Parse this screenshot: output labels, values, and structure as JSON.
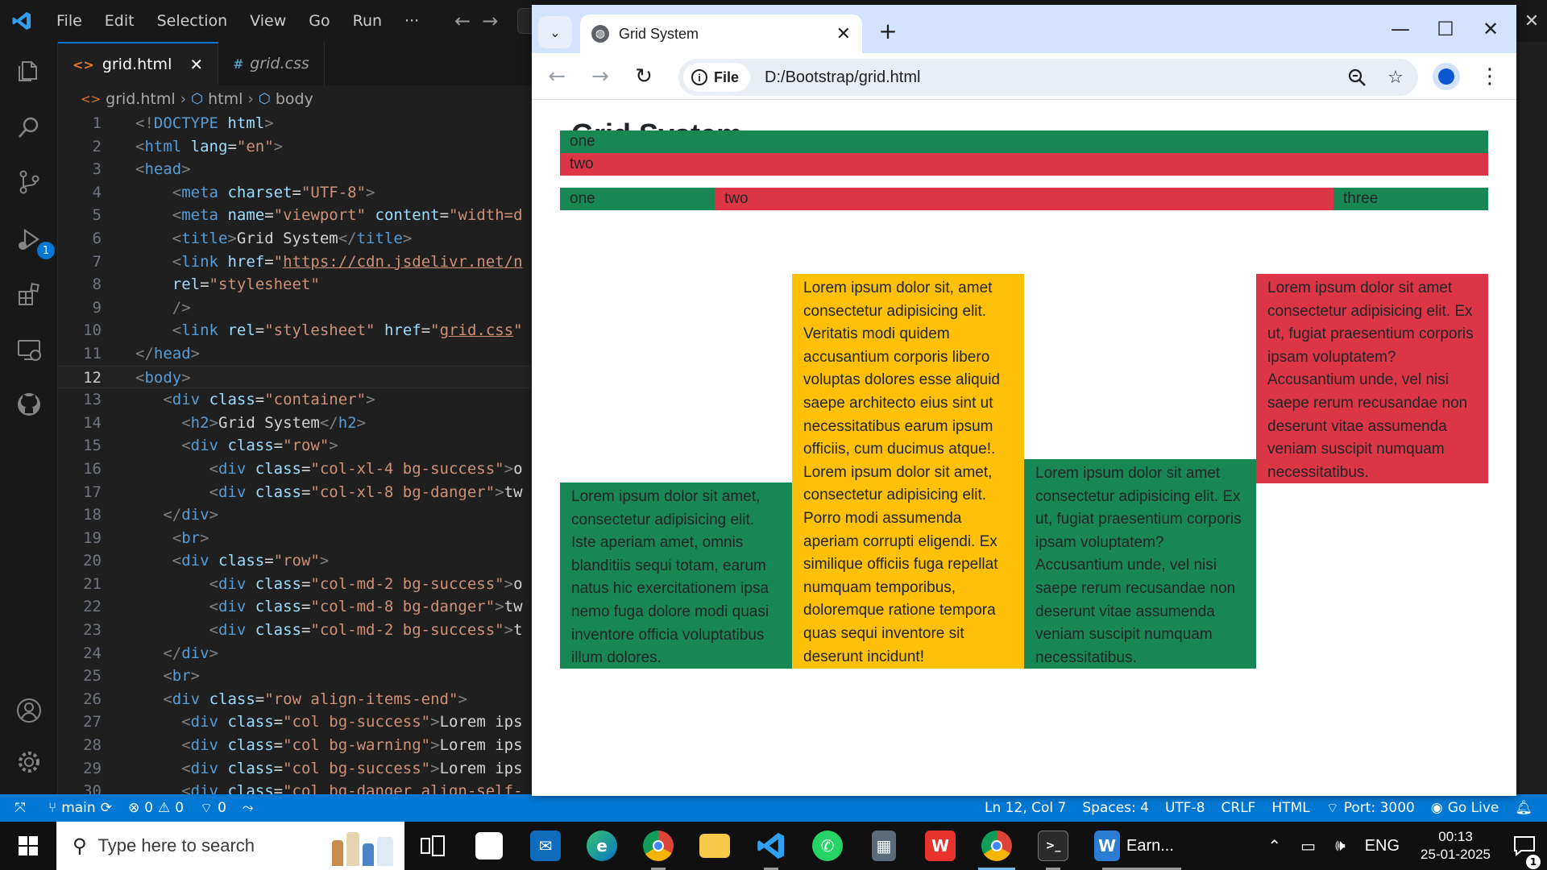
{
  "vscode": {
    "menu": [
      "File",
      "Edit",
      "Selection",
      "View",
      "Go",
      "Run",
      "···"
    ],
    "debug_badge": "1",
    "tabs": [
      {
        "label": "grid.html",
        "icon": "<>",
        "active": true
      },
      {
        "label": "grid.css",
        "icon": "#",
        "active": false
      }
    ],
    "breadcrumb": [
      "grid.html",
      "html",
      "body"
    ],
    "current_line": 12,
    "code_lines": [
      [
        [
          "br",
          "<!"
        ],
        [
          "tag",
          "DOCTYPE"
        ],
        [
          "txt",
          " "
        ],
        [
          "attr",
          "html"
        ],
        [
          "br",
          ">"
        ]
      ],
      [
        [
          "br",
          "<"
        ],
        [
          "tag",
          "html"
        ],
        [
          "txt",
          " "
        ],
        [
          "attr",
          "lang"
        ],
        [
          "txt",
          "="
        ],
        [
          "str",
          "\"en\""
        ],
        [
          "br",
          ">"
        ]
      ],
      [
        [
          "br",
          "<"
        ],
        [
          "tag",
          "head"
        ],
        [
          "br",
          ">"
        ]
      ],
      [
        [
          "txt",
          "    "
        ],
        [
          "br",
          "<"
        ],
        [
          "tag",
          "meta"
        ],
        [
          "txt",
          " "
        ],
        [
          "attr",
          "charset"
        ],
        [
          "txt",
          "="
        ],
        [
          "str",
          "\"UTF-8\""
        ],
        [
          "br",
          ">"
        ]
      ],
      [
        [
          "txt",
          "    "
        ],
        [
          "br",
          "<"
        ],
        [
          "tag",
          "meta"
        ],
        [
          "txt",
          " "
        ],
        [
          "attr",
          "name"
        ],
        [
          "txt",
          "="
        ],
        [
          "str",
          "\"viewport\""
        ],
        [
          "txt",
          " "
        ],
        [
          "attr",
          "content"
        ],
        [
          "txt",
          "="
        ],
        [
          "str",
          "\"width=d"
        ]
      ],
      [
        [
          "txt",
          "    "
        ],
        [
          "br",
          "<"
        ],
        [
          "tag",
          "title"
        ],
        [
          "br",
          ">"
        ],
        [
          "txt",
          "Grid System"
        ],
        [
          "br",
          "</"
        ],
        [
          "tag",
          "title"
        ],
        [
          "br",
          ">"
        ]
      ],
      [
        [
          "txt",
          "    "
        ],
        [
          "br",
          "<"
        ],
        [
          "tag",
          "link"
        ],
        [
          "txt",
          " "
        ],
        [
          "attr",
          "href"
        ],
        [
          "txt",
          "="
        ],
        [
          "str",
          "\""
        ],
        [
          "link",
          "https://cdn.jsdelivr.net/n"
        ]
      ],
      [
        [
          "txt",
          "    "
        ],
        [
          "attr",
          "rel"
        ],
        [
          "txt",
          "="
        ],
        [
          "str",
          "\"stylesheet\""
        ]
      ],
      [
        [
          "txt",
          "    "
        ],
        [
          "br",
          "/>"
        ]
      ],
      [
        [
          "txt",
          "    "
        ],
        [
          "br",
          "<"
        ],
        [
          "tag",
          "link"
        ],
        [
          "txt",
          " "
        ],
        [
          "attr",
          "rel"
        ],
        [
          "txt",
          "="
        ],
        [
          "str",
          "\"stylesheet\""
        ],
        [
          "txt",
          " "
        ],
        [
          "attr",
          "href"
        ],
        [
          "txt",
          "="
        ],
        [
          "str",
          "\""
        ],
        [
          "link",
          "grid.css"
        ],
        [
          "str",
          "\""
        ]
      ],
      [
        [
          "br",
          "</"
        ],
        [
          "tag",
          "head"
        ],
        [
          "br",
          ">"
        ]
      ],
      [
        [
          "br",
          "<"
        ],
        [
          "tag",
          "body"
        ],
        [
          "br",
          ">"
        ]
      ],
      [
        [
          "txt",
          "   "
        ],
        [
          "br",
          "<"
        ],
        [
          "tag",
          "div"
        ],
        [
          "txt",
          " "
        ],
        [
          "attr",
          "class"
        ],
        [
          "txt",
          "="
        ],
        [
          "str",
          "\"container\""
        ],
        [
          "br",
          ">"
        ]
      ],
      [
        [
          "txt",
          "     "
        ],
        [
          "br",
          "<"
        ],
        [
          "tag",
          "h2"
        ],
        [
          "br",
          ">"
        ],
        [
          "txt",
          "Grid System"
        ],
        [
          "br",
          "</"
        ],
        [
          "tag",
          "h2"
        ],
        [
          "br",
          ">"
        ]
      ],
      [
        [
          "txt",
          "     "
        ],
        [
          "br",
          "<"
        ],
        [
          "tag",
          "div"
        ],
        [
          "txt",
          " "
        ],
        [
          "attr",
          "class"
        ],
        [
          "txt",
          "="
        ],
        [
          "str",
          "\"row\""
        ],
        [
          "br",
          ">"
        ]
      ],
      [
        [
          "txt",
          "        "
        ],
        [
          "br",
          "<"
        ],
        [
          "tag",
          "div"
        ],
        [
          "txt",
          " "
        ],
        [
          "attr",
          "class"
        ],
        [
          "txt",
          "="
        ],
        [
          "str",
          "\"col-xl-4 bg-success\""
        ],
        [
          "br",
          ">"
        ],
        [
          "txt",
          "o"
        ]
      ],
      [
        [
          "txt",
          "        "
        ],
        [
          "br",
          "<"
        ],
        [
          "tag",
          "div"
        ],
        [
          "txt",
          " "
        ],
        [
          "attr",
          "class"
        ],
        [
          "txt",
          "="
        ],
        [
          "str",
          "\"col-xl-8 bg-danger\""
        ],
        [
          "br",
          ">"
        ],
        [
          "txt",
          "tw"
        ]
      ],
      [
        [
          "txt",
          "   "
        ],
        [
          "br",
          "</"
        ],
        [
          "tag",
          "div"
        ],
        [
          "br",
          ">"
        ]
      ],
      [
        [
          "txt",
          "    "
        ],
        [
          "br",
          "<"
        ],
        [
          "tag",
          "br"
        ],
        [
          "br",
          ">"
        ]
      ],
      [
        [
          "txt",
          "    "
        ],
        [
          "br",
          "<"
        ],
        [
          "tag",
          "div"
        ],
        [
          "txt",
          " "
        ],
        [
          "attr",
          "class"
        ],
        [
          "txt",
          "="
        ],
        [
          "str",
          "\"row\""
        ],
        [
          "br",
          ">"
        ]
      ],
      [
        [
          "txt",
          "        "
        ],
        [
          "br",
          "<"
        ],
        [
          "tag",
          "div"
        ],
        [
          "txt",
          " "
        ],
        [
          "attr",
          "class"
        ],
        [
          "txt",
          "="
        ],
        [
          "str",
          "\"col-md-2 bg-success\""
        ],
        [
          "br",
          ">"
        ],
        [
          "txt",
          "o"
        ]
      ],
      [
        [
          "txt",
          "        "
        ],
        [
          "br",
          "<"
        ],
        [
          "tag",
          "div"
        ],
        [
          "txt",
          " "
        ],
        [
          "attr",
          "class"
        ],
        [
          "txt",
          "="
        ],
        [
          "str",
          "\"col-md-8 bg-danger\""
        ],
        [
          "br",
          ">"
        ],
        [
          "txt",
          "tw"
        ]
      ],
      [
        [
          "txt",
          "        "
        ],
        [
          "br",
          "<"
        ],
        [
          "tag",
          "div"
        ],
        [
          "txt",
          " "
        ],
        [
          "attr",
          "class"
        ],
        [
          "txt",
          "="
        ],
        [
          "str",
          "\"col-md-2 bg-success\""
        ],
        [
          "br",
          ">"
        ],
        [
          "txt",
          "t"
        ]
      ],
      [
        [
          "txt",
          "   "
        ],
        [
          "br",
          "</"
        ],
        [
          "tag",
          "div"
        ],
        [
          "br",
          ">"
        ]
      ],
      [
        [
          "txt",
          "   "
        ],
        [
          "br",
          "<"
        ],
        [
          "tag",
          "br"
        ],
        [
          "br",
          ">"
        ]
      ],
      [
        [
          "txt",
          "   "
        ],
        [
          "br",
          "<"
        ],
        [
          "tag",
          "div"
        ],
        [
          "txt",
          " "
        ],
        [
          "attr",
          "class"
        ],
        [
          "txt",
          "="
        ],
        [
          "str",
          "\"row align-items-end\""
        ],
        [
          "br",
          ">"
        ]
      ],
      [
        [
          "txt",
          "     "
        ],
        [
          "br",
          "<"
        ],
        [
          "tag",
          "div"
        ],
        [
          "txt",
          " "
        ],
        [
          "attr",
          "class"
        ],
        [
          "txt",
          "="
        ],
        [
          "str",
          "\"col bg-success\""
        ],
        [
          "br",
          ">"
        ],
        [
          "txt",
          "Lorem ips"
        ]
      ],
      [
        [
          "txt",
          "     "
        ],
        [
          "br",
          "<"
        ],
        [
          "tag",
          "div"
        ],
        [
          "txt",
          " "
        ],
        [
          "attr",
          "class"
        ],
        [
          "txt",
          "="
        ],
        [
          "str",
          "\"col bg-warning\""
        ],
        [
          "br",
          ">"
        ],
        [
          "txt",
          "Lorem ips"
        ]
      ],
      [
        [
          "txt",
          "     "
        ],
        [
          "br",
          "<"
        ],
        [
          "tag",
          "div"
        ],
        [
          "txt",
          " "
        ],
        [
          "attr",
          "class"
        ],
        [
          "txt",
          "="
        ],
        [
          "str",
          "\"col bg-success\""
        ],
        [
          "br",
          ">"
        ],
        [
          "txt",
          "Lorem ips"
        ]
      ],
      [
        [
          "txt",
          "     "
        ],
        [
          "br",
          "<"
        ],
        [
          "tag",
          "div"
        ],
        [
          "txt",
          " "
        ],
        [
          "attr",
          "class"
        ],
        [
          "txt",
          "="
        ],
        [
          "str",
          "\"col bg-danger align-self-"
        ]
      ]
    ],
    "status": {
      "branch": "main",
      "errors": "0",
      "warnings": "0",
      "ports_count": "0",
      "position": "Ln 12, Col 7",
      "spaces": "Spaces: 4",
      "encoding": "UTF-8",
      "eol": "CRLF",
      "language": "HTML",
      "port": "Port: 3000",
      "golive": "Go Live"
    }
  },
  "chrome": {
    "tab_title": "Grid System",
    "chip_label": "File",
    "url": "D:/Bootstrap/grid.html"
  },
  "page": {
    "heading": "Grid System",
    "row1": [
      "one",
      "two"
    ],
    "row2": [
      "one",
      "two",
      "three"
    ],
    "lorem": [
      "Lorem ipsum dolor sit amet, consectetur adipisicing elit. Iste aperiam amet, omnis blanditiis sequi totam, earum natus hic exercitationem ipsa nemo fuga dolore modi quasi inventore officia voluptatibus illum dolores.",
      "Lorem ipsum dolor sit, amet consectetur adipisicing elit. Veritatis modi quidem accusantium corporis libero voluptas dolores esse aliquid saepe architecto eius sint ut necessitatibus earum ipsum officiis, cum ducimus atque!. Lorem ipsum dolor sit amet, consectetur adipisicing elit. Porro modi assumenda aperiam corrupti eligendi. Ex similique officiis fuga repellat numquam temporibus, doloremque ratione tempora quas sequi inventore sit deserunt incidunt!",
      "Lorem ipsum dolor sit amet consectetur adipisicing elit. Ex ut, fugiat praesentium corporis ipsam voluptatem? Accusantium unde, vel nisi saepe rerum recusandae non deserunt vitae assumenda veniam suscipit numquam necessitatibus.",
      "Lorem ipsum dolor sit amet consectetur adipisicing elit. Ex ut, fugiat praesentium corporis ipsam voluptatem? Accusantium unde, vel nisi saepe rerum recusandae non deserunt vitae assumenda veniam suscipit numquam necessitatibus."
    ],
    "colors": {
      "success": "#198754",
      "danger": "#dc3545",
      "warning": "#ffc107"
    }
  },
  "taskbar": {
    "search_placeholder": "Type here to search",
    "word_label": "Earn...",
    "language": "ENG",
    "time": "00:13",
    "date": "25-01-2025",
    "notification_count": "1"
  }
}
